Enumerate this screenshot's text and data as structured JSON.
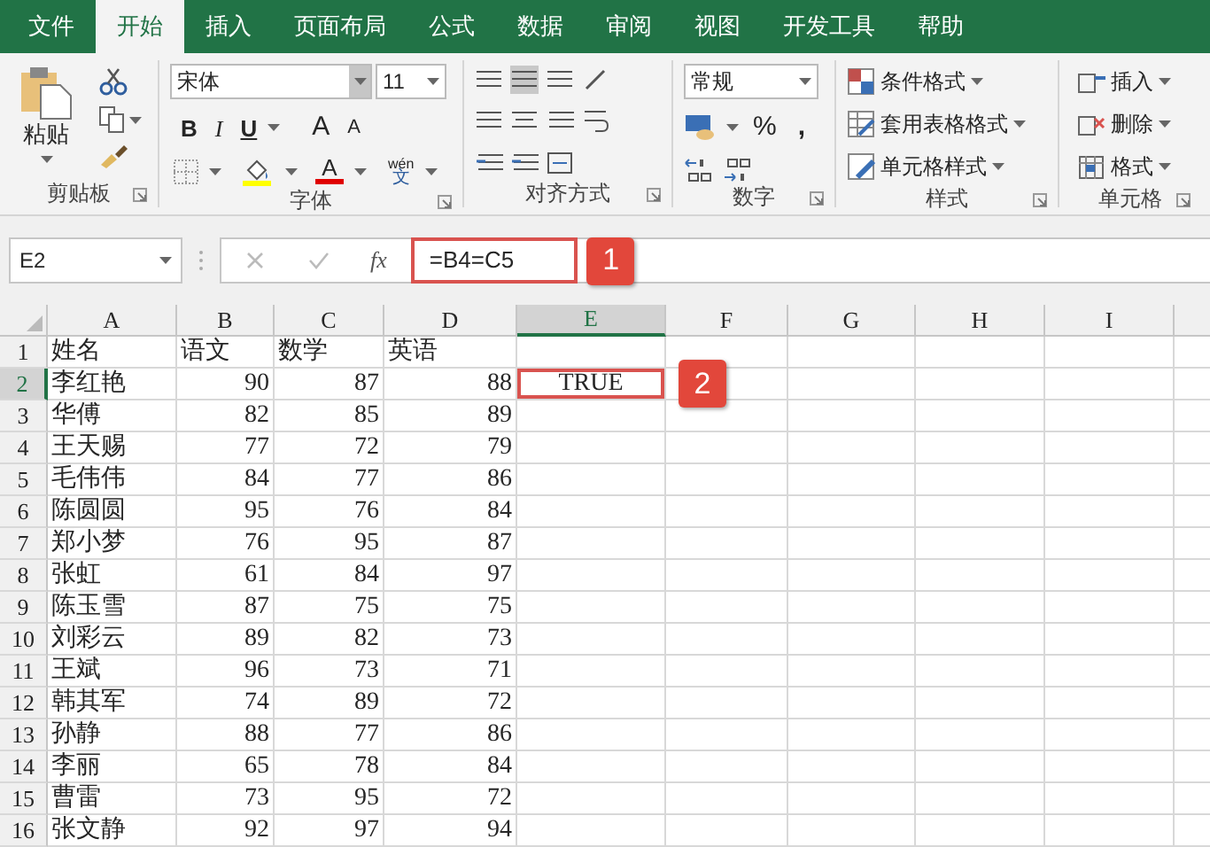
{
  "tabs": [
    {
      "label": "文件",
      "selected": false
    },
    {
      "label": "开始",
      "selected": true
    },
    {
      "label": "插入",
      "selected": false
    },
    {
      "label": "页面布局",
      "selected": false
    },
    {
      "label": "公式",
      "selected": false
    },
    {
      "label": "数据",
      "selected": false
    },
    {
      "label": "审阅",
      "selected": false
    },
    {
      "label": "视图",
      "selected": false
    },
    {
      "label": "开发工具",
      "selected": false
    },
    {
      "label": "帮助",
      "selected": false
    }
  ],
  "ribbon": {
    "clipboard": {
      "label": "剪贴板",
      "paste": "粘贴"
    },
    "font": {
      "label": "字体",
      "font_name": "宋体",
      "font_size": "11",
      "bold": "B",
      "italic": "I",
      "underline": "U",
      "grow_font": "A",
      "shrink_font": "A",
      "font_color": "A",
      "phonetic_top": "wén",
      "phonetic_bottom": "文"
    },
    "alignment": {
      "label": "对齐方式"
    },
    "number": {
      "label": "数字",
      "format": "常规",
      "percent": "%",
      "comma": ","
    },
    "styles": {
      "label": "样式",
      "buttons": [
        "条件格式",
        "套用表格格式",
        "单元格样式"
      ]
    },
    "cells": {
      "label": "单元格",
      "buttons": [
        "插入",
        "删除",
        "格式"
      ]
    }
  },
  "name_box": "E2",
  "formula_bar": {
    "fx": "fx",
    "formula": "=B4=C5"
  },
  "callouts": [
    {
      "label": "1",
      "kind": "formula"
    },
    {
      "label": "2",
      "kind": "cell"
    }
  ],
  "columns": [
    {
      "label": "A",
      "kind": "text",
      "selected": false
    },
    {
      "label": "B",
      "kind": "number",
      "selected": false
    },
    {
      "label": "C",
      "kind": "number",
      "selected": false
    },
    {
      "label": "D",
      "kind": "number",
      "selected": false
    },
    {
      "label": "E",
      "kind": "boolean",
      "selected": true
    },
    {
      "label": "F",
      "kind": "text",
      "selected": false
    },
    {
      "label": "G",
      "kind": "text",
      "selected": false
    },
    {
      "label": "H",
      "kind": "text",
      "selected": false
    },
    {
      "label": "I",
      "kind": "text",
      "selected": false
    }
  ],
  "rows": [
    {
      "header": "1",
      "kind": "header",
      "selected": false,
      "cells": [
        "姓名",
        "语文",
        "数学",
        "英语"
      ]
    },
    {
      "header": "2",
      "kind": "data",
      "selected": true,
      "cells": [
        "李红艳",
        "90",
        "87",
        "88",
        "TRUE"
      ]
    },
    {
      "header": "3",
      "kind": "data",
      "selected": false,
      "cells": [
        "华傅",
        "82",
        "85",
        "89"
      ]
    },
    {
      "header": "4",
      "kind": "data",
      "selected": false,
      "cells": [
        "王天赐",
        "77",
        "72",
        "79"
      ]
    },
    {
      "header": "5",
      "kind": "data",
      "selected": false,
      "cells": [
        "毛伟伟",
        "84",
        "77",
        "86"
      ]
    },
    {
      "header": "6",
      "kind": "data",
      "selected": false,
      "cells": [
        "陈圆圆",
        "95",
        "76",
        "84"
      ]
    },
    {
      "header": "7",
      "kind": "data",
      "selected": false,
      "cells": [
        "郑小梦",
        "76",
        "95",
        "87"
      ]
    },
    {
      "header": "8",
      "kind": "data",
      "selected": false,
      "cells": [
        "张虹",
        "61",
        "84",
        "97"
      ]
    },
    {
      "header": "9",
      "kind": "data",
      "selected": false,
      "cells": [
        "陈玉雪",
        "87",
        "75",
        "75"
      ]
    },
    {
      "header": "10",
      "kind": "data",
      "selected": false,
      "cells": [
        "刘彩云",
        "89",
        "82",
        "73"
      ]
    },
    {
      "header": "11",
      "kind": "data",
      "selected": false,
      "cells": [
        "王斌",
        "96",
        "73",
        "71"
      ]
    },
    {
      "header": "12",
      "kind": "data",
      "selected": false,
      "cells": [
        "韩其军",
        "74",
        "89",
        "72"
      ]
    },
    {
      "header": "13",
      "kind": "data",
      "selected": false,
      "cells": [
        "孙静",
        "88",
        "77",
        "86"
      ]
    },
    {
      "header": "14",
      "kind": "data",
      "selected": false,
      "cells": [
        "李丽",
        "65",
        "78",
        "84"
      ]
    },
    {
      "header": "15",
      "kind": "data",
      "selected": false,
      "cells": [
        "曹雷",
        "73",
        "95",
        "72"
      ]
    },
    {
      "header": "16",
      "kind": "data",
      "selected": false,
      "cells": [
        "张文静",
        "92",
        "97",
        "94"
      ]
    }
  ]
}
